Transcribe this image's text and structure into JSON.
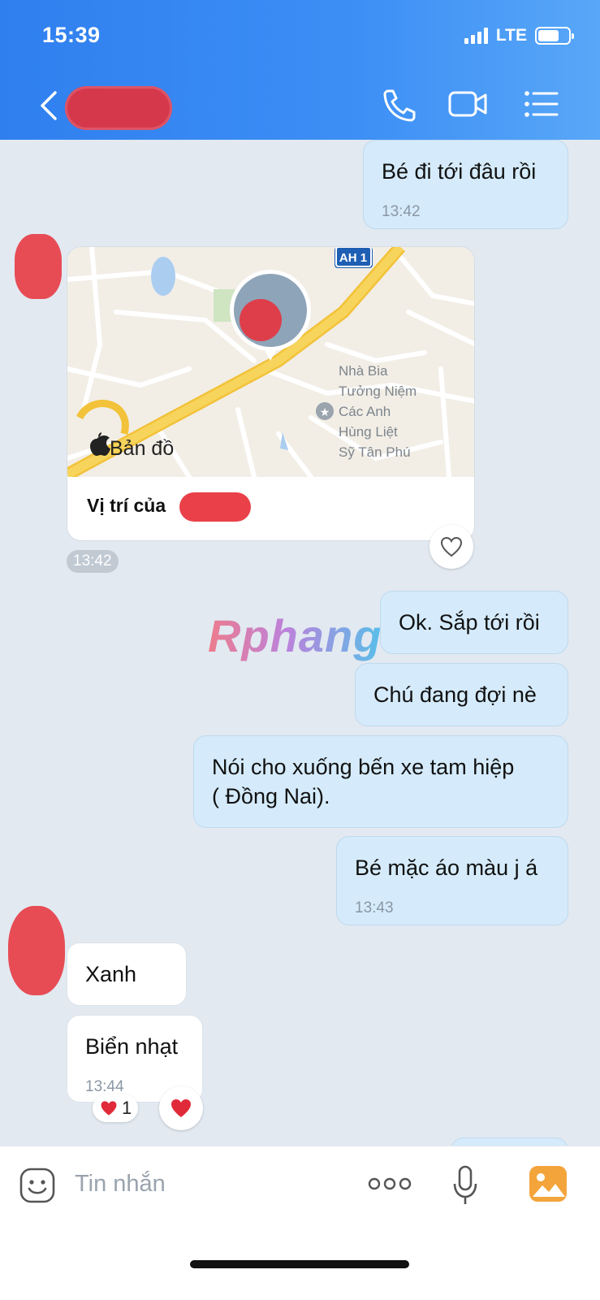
{
  "status_bar": {
    "time": "15:39",
    "network": "LTE"
  },
  "header": {
    "back_icon": "chevron-left-icon",
    "call_icon": "phone-icon",
    "video_icon": "video-camera-icon",
    "menu_icon": "list-menu-icon"
  },
  "messages": [
    {
      "direction": "out",
      "text": "Bé đi tới đâu rồi",
      "time": "13:42"
    },
    {
      "direction": "in",
      "type": "location",
      "map_labels": {
        "road": "AH 1",
        "poi": [
          "Nhà Bia",
          "Tưởng Niệm",
          "Các Anh",
          "Hùng Liệt",
          "Sỹ Tân Phú"
        ],
        "brand": "Bản đồ"
      },
      "caption": "Vị trí của",
      "time": "13:42"
    },
    {
      "direction": "out",
      "text": "Ok. Sắp tới rồi"
    },
    {
      "direction": "out",
      "text": "Chú đang đợi nè"
    },
    {
      "direction": "out",
      "text_line1": "Nói cho xuống bến xe tam hiệp",
      "text_line2": "( Đồng Nai)."
    },
    {
      "direction": "out",
      "text": "Bé mặc áo màu j á",
      "time": "13:43"
    },
    {
      "direction": "in",
      "text": "Xanh"
    },
    {
      "direction": "in",
      "text": "Biển nhạt",
      "time": "13:44",
      "reaction_count": "1"
    }
  ],
  "watermark": "Rphang",
  "composer": {
    "placeholder": "Tin nhắn"
  },
  "colors": {
    "header_start": "#2f7fef",
    "header_end": "#58a7f8",
    "outgoing_bubble": "#d5ebfb",
    "background": "#e2e9f1"
  }
}
